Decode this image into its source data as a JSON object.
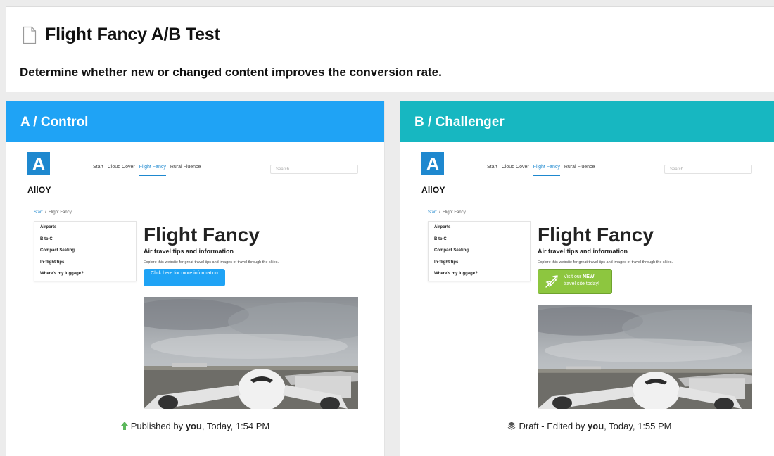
{
  "page": {
    "title": "Flight Fancy A/B Test",
    "subtitle": "Determine whether new or changed content improves the conversion rate."
  },
  "variants": [
    {
      "label": "A / Control",
      "color": "#1fa3f5",
      "preview": {
        "logo_letter": "A",
        "logo_word": "AllOY",
        "nav": [
          "Start",
          "Cloud Cover",
          "Flight Fancy",
          "Rural Fluence"
        ],
        "nav_active": "Flight Fancy",
        "search_placeholder": "Search",
        "breadcrumb": [
          "Start",
          "Flight Fancy"
        ],
        "breadcrumb_sep": "/",
        "menu": [
          "Airports",
          "B to C",
          "Compact Seating",
          "In-flight tips",
          "Where's my luggage?"
        ],
        "site_title": "Flight Fancy",
        "site_subtitle": "Air travel tips and information",
        "site_description": "Explore this website for great travel tips and images of travel through the skies.",
        "cta": "Click here for more information"
      },
      "status_icon": "arrow-up-icon",
      "status_prefix": "Published by ",
      "status_user": "you",
      "status_suffix": ", Today, 1:54 PM"
    },
    {
      "label": "B / Challenger",
      "color": "#17b7c1",
      "preview": {
        "logo_letter": "A",
        "logo_word": "AllOY",
        "nav": [
          "Start",
          "Cloud Cover",
          "Flight Fancy",
          "Rural Fluence"
        ],
        "nav_active": "Flight Fancy",
        "search_placeholder": "Search",
        "breadcrumb": [
          "Start",
          "Flight Fancy"
        ],
        "breadcrumb_sep": "/",
        "menu": [
          "Airports",
          "B to C",
          "Compact Seating",
          "In-flight tips",
          "Where's my luggage?"
        ],
        "site_title": "Flight Fancy",
        "site_subtitle": "Air travel tips and information",
        "site_description": "Explore this website for great travel tips and images of travel through the skies.",
        "cta_line1_prefix": "Visit our ",
        "cta_line1_bold": "NEW",
        "cta_line2": "travel site today!"
      },
      "status_icon": "layers-icon",
      "status_prefix": "Draft - Edited by ",
      "status_user": "you",
      "status_suffix": ", Today, 1:55 PM"
    }
  ]
}
